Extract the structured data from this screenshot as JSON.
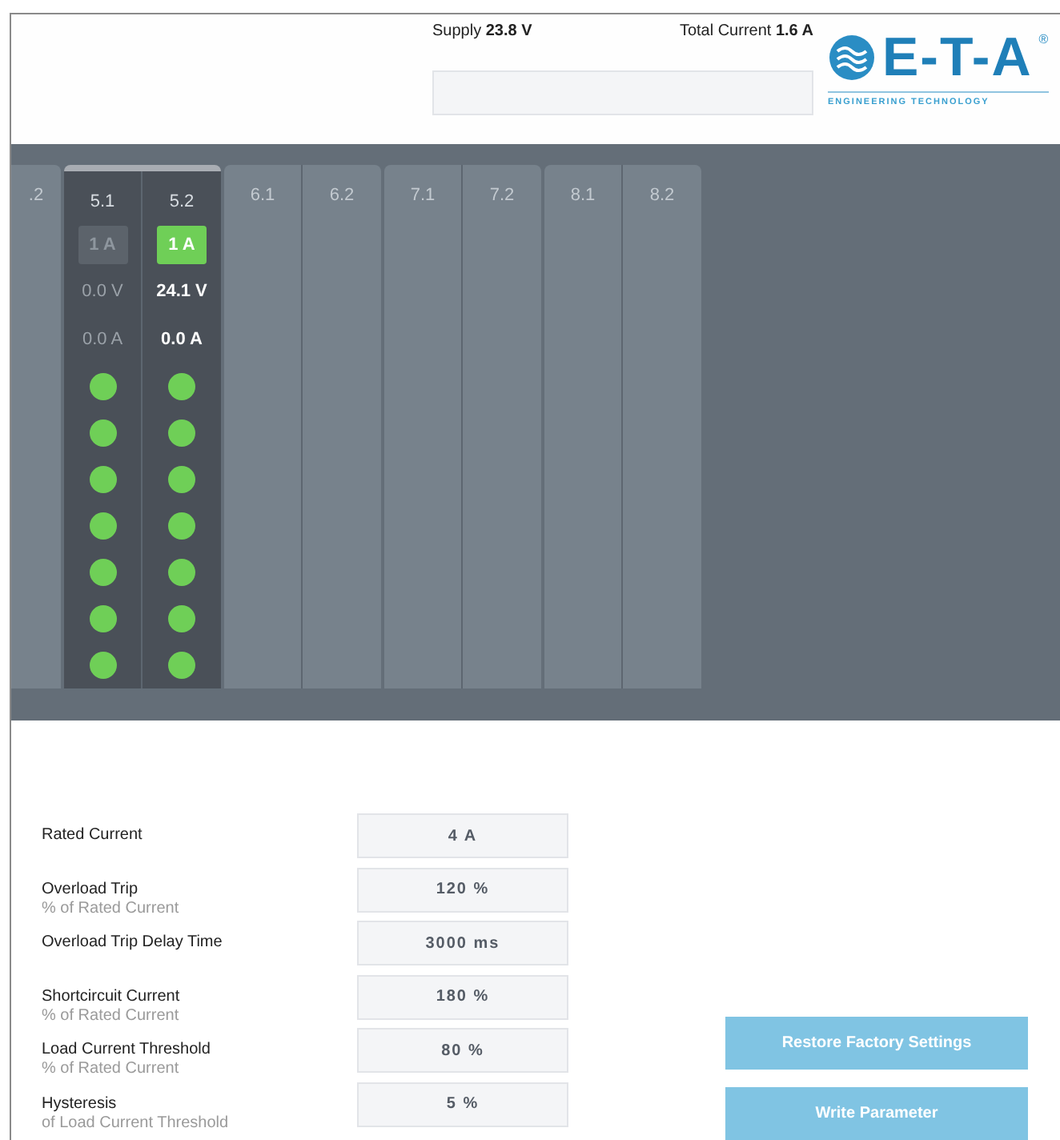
{
  "header": {
    "supply": {
      "label": "Supply",
      "value": "23.8 V"
    },
    "total_current": {
      "label": "Total Current",
      "value": "1.6 A"
    },
    "logo": {
      "mark": "E-T-A",
      "registered": "®",
      "tagline": "ENGINEERING TECHNOLOGY"
    }
  },
  "modules": [
    {
      "active": false,
      "partial": true,
      "channels": [
        {
          "label": ".2"
        }
      ]
    },
    {
      "active": true,
      "channels": [
        {
          "label": "5.1",
          "on": false,
          "rating": "1 A",
          "voltage": "0.0 V",
          "current": "0.0 A",
          "leds": [
            {
              "color": "#6fcf57"
            },
            {
              "color": "#6fcf57"
            },
            {
              "color": "#6fcf57"
            },
            {
              "color": "#6fcf57"
            },
            {
              "color": "#6fcf57"
            },
            {
              "color": "#6fcf57"
            },
            {
              "color": "#6fcf57"
            }
          ]
        },
        {
          "label": "5.2",
          "on": true,
          "rating": "1 A",
          "voltage": "24.1 V",
          "current": "0.0 A",
          "leds": [
            {
              "color": "#6fcf57"
            },
            {
              "color": "#6fcf57"
            },
            {
              "color": "#6fcf57"
            },
            {
              "color": "#6fcf57"
            },
            {
              "color": "#6fcf57"
            },
            {
              "color": "#6fcf57"
            },
            {
              "color": "#6fcf57"
            }
          ]
        }
      ]
    },
    {
      "active": false,
      "channels": [
        {
          "label": "6.1"
        },
        {
          "label": "6.2"
        }
      ]
    },
    {
      "active": false,
      "channels": [
        {
          "label": "7.1"
        },
        {
          "label": "7.2"
        }
      ]
    },
    {
      "active": false,
      "channels": [
        {
          "label": "8.1"
        },
        {
          "label": "8.2"
        }
      ]
    }
  ],
  "parameters": [
    {
      "label": "Rated Current",
      "value": "4 A"
    },
    {
      "label": "Overload Trip",
      "sublabel": "% of Rated Current",
      "value": "120 %"
    },
    {
      "label": "Overload Trip Delay Time",
      "value": "3000 ms"
    },
    {
      "label": "Shortcircuit Current",
      "sublabel": "% of Rated Current",
      "value": "180 %"
    },
    {
      "label": "Load Current Threshold",
      "sublabel": "% of Rated Current",
      "value": "80 %"
    },
    {
      "label": "Hysteresis",
      "sublabel": "of Load Current Threshold",
      "value": "5 %"
    }
  ],
  "buttons": [
    "Restore Factory Settings",
    "Write Parameter"
  ]
}
